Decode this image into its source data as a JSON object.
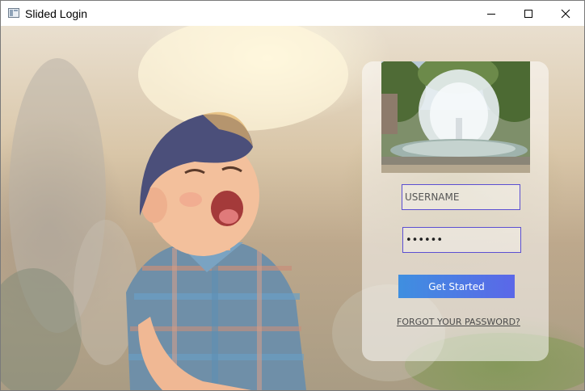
{
  "window": {
    "title": "Slided Login",
    "icon": "application-window-icon",
    "controls": {
      "minimize": "minimize-icon",
      "maximize": "maximize-icon",
      "close": "close-icon"
    }
  },
  "background": {
    "description_icon": "photo-background"
  },
  "login_card": {
    "username": {
      "placeholder": "USERNAME",
      "value": ""
    },
    "password": {
      "value": "••••••"
    },
    "submit_label": "Get Started",
    "forgot_label": "FORGOT YOUR PASSWORD?"
  },
  "colors": {
    "field_border": "#5b4fd2",
    "button_start": "#3f8fe0",
    "button_end": "#5b67e8",
    "button_text": "#ffffff"
  }
}
